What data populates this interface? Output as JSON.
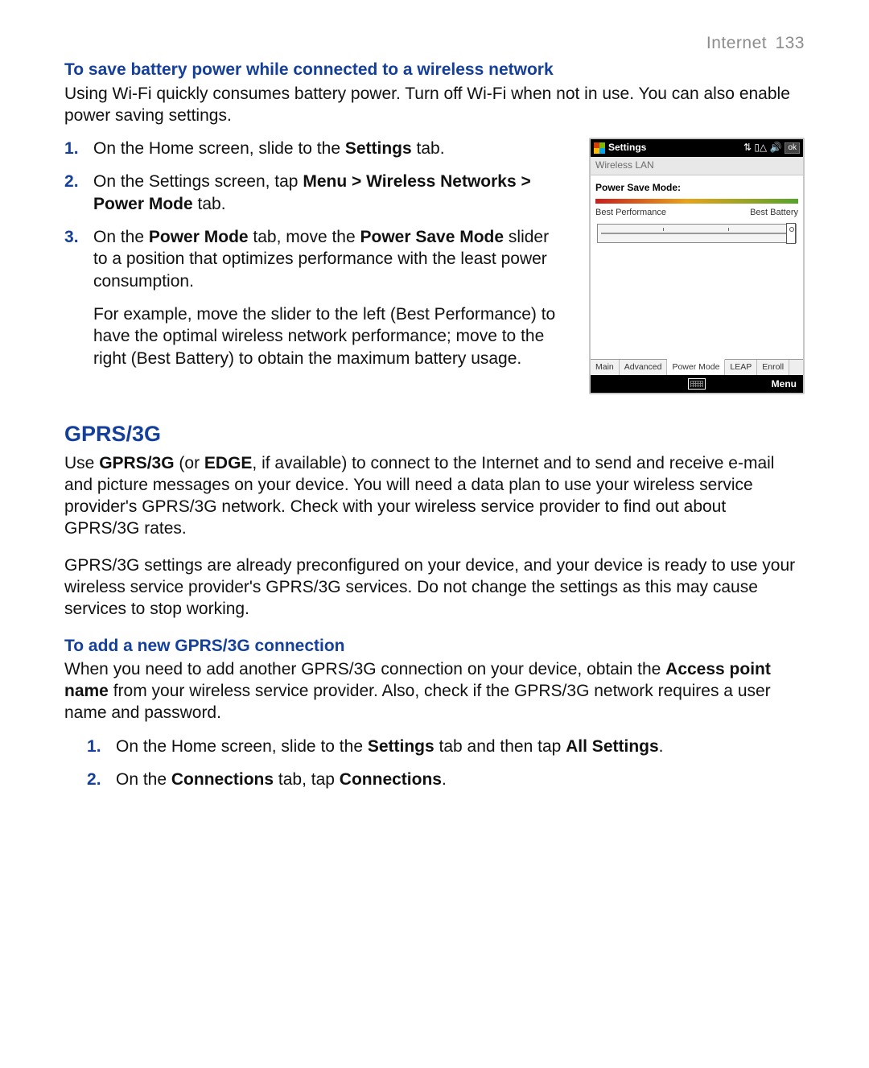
{
  "header": {
    "chapter": "Internet",
    "page": "133"
  },
  "sec1": {
    "title": "To save battery power while connected to a wireless network",
    "intro": "Using Wi-Fi quickly consumes battery power. Turn off Wi-Fi when not in use. You can also enable power saving settings.",
    "steps": {
      "s1": {
        "num": "1",
        "a": "On the Home screen, slide to the ",
        "b": "Settings",
        "c": " tab."
      },
      "s2": {
        "num": "2",
        "a": "On the Settings screen, tap ",
        "b": "Menu > Wireless Networks > Power Mode",
        "c": " tab."
      },
      "s3": {
        "num": "3",
        "a": "On the ",
        "b": "Power Mode",
        "c": " tab, move the ",
        "d": "Power Save Mode",
        "e": " slider to a position that optimizes performance with the least power consumption."
      },
      "s3b": "For example, move the slider to the left (Best Performance) to have the optimal wireless network performance; move to the right (Best Battery) to obtain the maximum battery usage."
    }
  },
  "screenshot": {
    "title": "Settings",
    "icons": "⇅ ▯△ 🔊",
    "ok": "ok",
    "subtitle": "Wireless LAN",
    "label": "Power Save Mode:",
    "left": "Best Performance",
    "right": "Best Battery",
    "tabs": {
      "t1": "Main",
      "t2": "Advanced",
      "t3": "Power Mode",
      "t4": "LEAP",
      "t5": "Enroll"
    },
    "menu": "Menu"
  },
  "sec2": {
    "title": "GPRS/3G",
    "p1a": "Use ",
    "p1b": "GPRS/3G",
    "p1c": " (or ",
    "p1d": "EDGE",
    "p1e": ", if available) to connect to the Internet and to send and receive e-mail and picture messages on your device. You will need a data plan to use your wireless service provider's GPRS/3G network. Check with your wireless service provider to find out about GPRS/3G rates.",
    "p2": "GPRS/3G settings are already preconfigured on your device, and your device is ready to use your wireless service provider's GPRS/3G services. Do not change the settings as this may cause services to stop working."
  },
  "sec3": {
    "title": "To add a new GPRS/3G connection",
    "p1a": "When you need to add another GPRS/3G connection on your device, obtain the ",
    "p1b": "Access point name",
    "p1c": " from your wireless service provider. Also, check if the GPRS/3G network requires a user name and password.",
    "steps": {
      "s1": {
        "num": "1",
        "a": "On the Home screen, slide to the ",
        "b": "Settings",
        "c": " tab and then tap ",
        "d": "All Settings",
        "e": "."
      },
      "s2": {
        "num": "2",
        "a": "On the ",
        "b": "Connections",
        "c": " tab, tap ",
        "d": "Connections",
        "e": "."
      }
    }
  }
}
